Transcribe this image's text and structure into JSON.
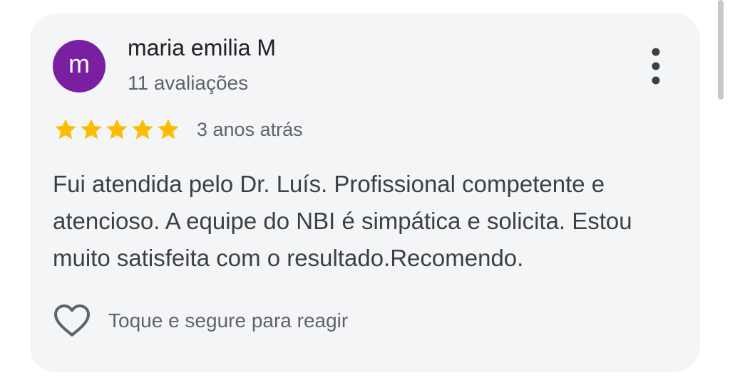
{
  "review": {
    "avatar": {
      "initial": "m",
      "color": "#7b1fa2"
    },
    "reviewer_name": "maria emilia M",
    "reviews_count": "11 avaliações",
    "rating": 5,
    "rating_max": 5,
    "star_color": "#fbbc04",
    "date": "3 anos atrás",
    "text": "Fui atendida pelo Dr. Luís. Profissional competente e atencioso. A equipe do NBI é simpática e solicita. Estou muito satisfeita com o resultado.Recomendo.",
    "react_label": "Toque e segure para reagir"
  },
  "icons": {
    "more": "more-vert-icon",
    "react": "heart-outline-icon",
    "star": "star-icon"
  },
  "colors": {
    "card_background": "#f4f5f7",
    "primary_text": "#202124",
    "secondary_text": "#5f6368"
  }
}
